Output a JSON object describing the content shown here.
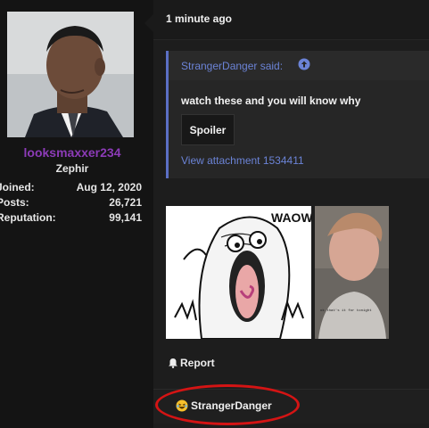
{
  "user": {
    "name": "looksmaxxer234",
    "title": "Zephir",
    "stats": [
      {
        "label": "Joined:",
        "value": "Aug 12, 2020"
      },
      {
        "label": "Posts:",
        "value": "26,721"
      },
      {
        "label": "Reputation:",
        "value": "99,141"
      }
    ]
  },
  "post": {
    "time": "1 minute ago",
    "quote": {
      "author": "StrangerDanger said:",
      "text": "watch these and you will know why",
      "spoiler_label": "Spoiler",
      "attachment": "View attachment 1534411"
    },
    "images": [
      {
        "caption": "WAOW!"
      },
      {
        "caption": "ok that's it for tonight"
      }
    ],
    "report_label": "Report",
    "reaction": {
      "name": "StrangerDanger",
      "emoji": "laughing-emoji"
    }
  },
  "colors": {
    "username": "#8c3bb7",
    "link": "#6b83d6",
    "quote_border": "#5b6fc4",
    "highlight_circle": "#d41414"
  }
}
